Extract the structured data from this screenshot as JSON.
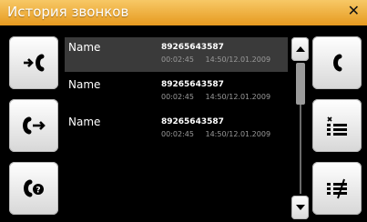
{
  "window": {
    "title": "История звонков"
  },
  "calls": [
    {
      "name": "Name",
      "phone": "89265643587",
      "duration": "00:02:45",
      "datetime": "14:50/12.01.2009"
    },
    {
      "name": "Name",
      "phone": "89265643587",
      "duration": "00:02:45",
      "datetime": "14:50/12.01.2009"
    },
    {
      "name": "Name",
      "phone": "89265643587",
      "duration": "00:02:45",
      "datetime": "14:50/12.01.2009"
    }
  ],
  "selected_row": 1,
  "icons": {
    "incoming": "incoming-call-icon",
    "outgoing": "outgoing-call-icon",
    "missed": "missed-call-icon",
    "call": "phone-call-icon",
    "delete_one": "delete-item-icon",
    "delete_all": "delete-all-icon",
    "close": "close-icon"
  },
  "colors": {
    "titlebar_top": "#f7c866",
    "titlebar_bottom": "#e69a1f",
    "selected_row": "#3a3a3a"
  }
}
